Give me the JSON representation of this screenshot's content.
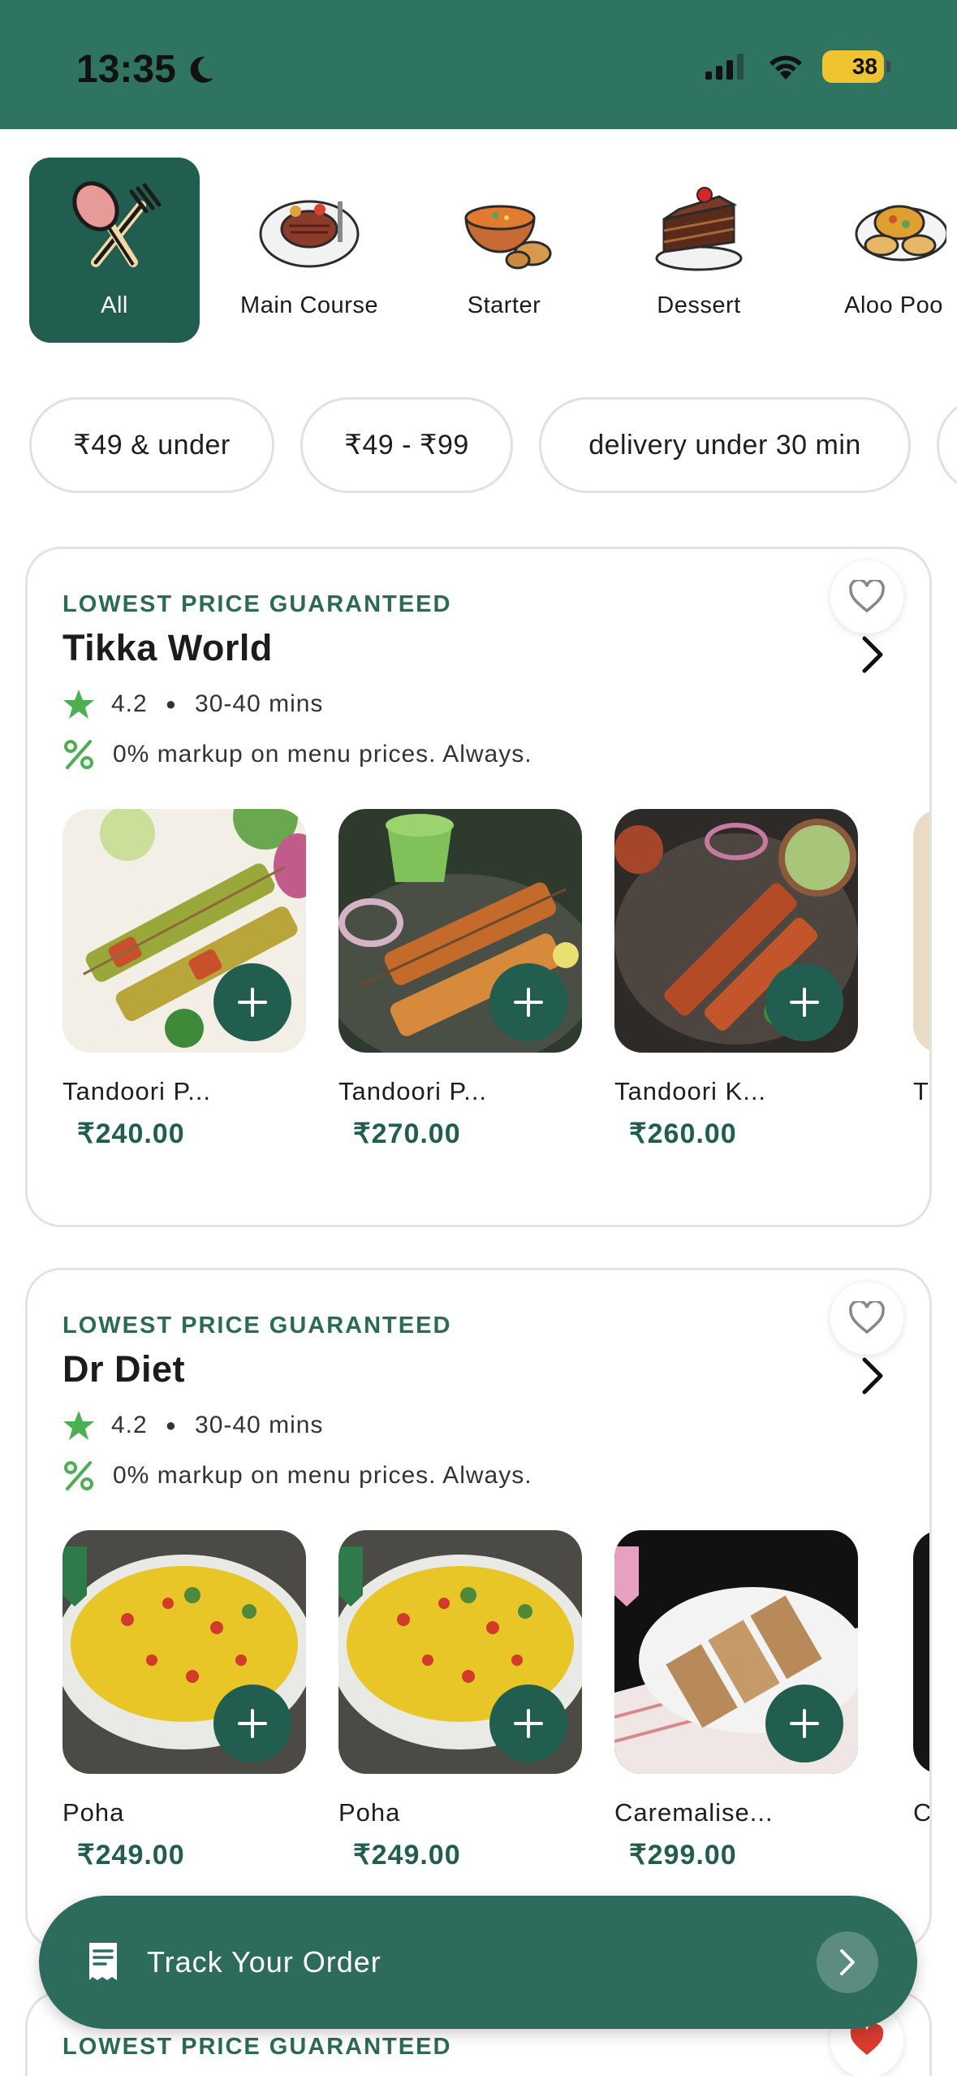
{
  "status_bar": {
    "time": "13:35",
    "battery": "38"
  },
  "categories": [
    {
      "label": "All",
      "active": true,
      "icon": "fork-spoon-icon"
    },
    {
      "label": "Main Course",
      "active": false,
      "icon": "steak-plate-icon"
    },
    {
      "label": "Starter",
      "active": false,
      "icon": "soup-bowl-icon"
    },
    {
      "label": "Dessert",
      "active": false,
      "icon": "cake-slice-icon"
    },
    {
      "label": "Aloo Poo",
      "active": false,
      "icon": "aloo-poori-icon"
    }
  ],
  "filters": [
    "₹49 & under",
    "₹49 - ₹99",
    "delivery under 30 min"
  ],
  "restaurants": [
    {
      "tag": "LOWEST PRICE GUARANTEED",
      "name": "Tikka World",
      "rating": "4.2",
      "time": "30-40 mins",
      "markup": "0% markup on menu prices. Always.",
      "favorite": false,
      "items": [
        {
          "name": "Tandoori P...",
          "price": "₹240.00"
        },
        {
          "name": "Tandoori P...",
          "price": "₹270.00"
        },
        {
          "name": "Tandoori K...",
          "price": "₹260.00"
        },
        {
          "name": "T",
          "price": ""
        }
      ]
    },
    {
      "tag": "LOWEST PRICE GUARANTEED",
      "name": "Dr Diet",
      "rating": "4.2",
      "time": "30-40 mins",
      "markup": "0% markup on menu prices. Always.",
      "favorite": false,
      "items": [
        {
          "name": "Poha",
          "price": "₹249.00"
        },
        {
          "name": "Poha",
          "price": "₹249.00"
        },
        {
          "name": "Caremalise...",
          "price": "₹299.00"
        },
        {
          "name": "C",
          "price": ""
        }
      ]
    },
    {
      "tag": "LOWEST PRICE GUARANTEED",
      "favorite": true
    }
  ],
  "track_order": {
    "label": "Track Your Order"
  },
  "colors": {
    "brand": "#225e4f",
    "header": "#2f7460",
    "accent_star": "#4caf50",
    "heart_filled": "#d93b30"
  }
}
